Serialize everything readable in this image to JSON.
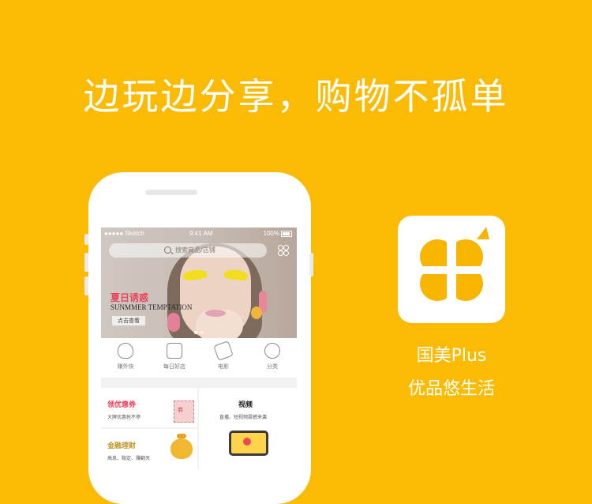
{
  "headline": "边玩边分享，购物不孤单",
  "app": {
    "name": "国美Plus",
    "slogan": "优品悠生活",
    "brand_color": "#fbbb05"
  },
  "phone": {
    "status_bar": {
      "carrier": "●●●●● Sketch",
      "time": "9:41 AM",
      "battery": "100%"
    },
    "search": {
      "placeholder": "搜索商品/店铺",
      "icon": "search-icon"
    },
    "banner": {
      "title": "夏日诱惑",
      "subtitle": "SUNMMER TEMPTATION",
      "button": "点击查看"
    },
    "nav": [
      {
        "label": "赚外快",
        "icon": "money-bag-icon"
      },
      {
        "label": "每日好店",
        "icon": "shop-icon"
      },
      {
        "label": "电影",
        "icon": "ticket-icon"
      },
      {
        "label": "分类",
        "icon": "category-icon"
      }
    ],
    "cards": {
      "coupon": {
        "title": "领优惠券",
        "desc": "大牌优惠抢不停",
        "icon_text": "券",
        "title_color": "#e8455a"
      },
      "finance": {
        "title": "金融理财",
        "desc": "高息、稳定、赚翻天",
        "title_color": "#c3962a"
      },
      "video": {
        "title": "视频",
        "desc": "直播、短视频震撼来袭"
      }
    }
  }
}
